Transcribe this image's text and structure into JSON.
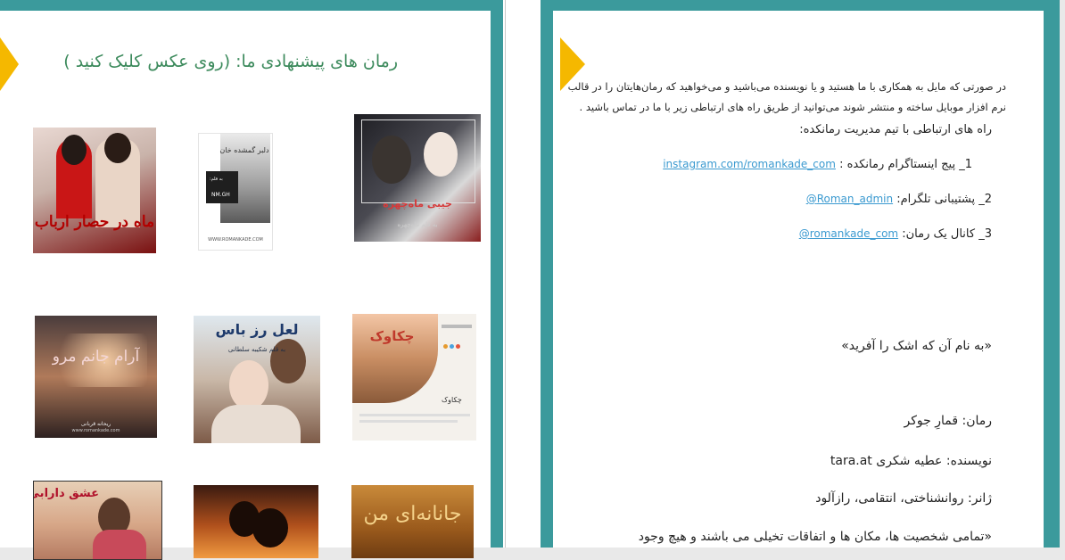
{
  "left_page": {
    "title": "رمان های پیشنهادی ما: (روی عکس کلیک کنید )",
    "covers": [
      {
        "name": "جیبی ماه‌چهره",
        "caption": "به قلم ماه‌چهره",
        "accent": "#c0392b"
      },
      {
        "name": "دلبر گمشده خان",
        "byline": "به قلم:",
        "author": "NM.GH",
        "site": "WWW.ROMANKADE.COM"
      },
      {
        "name": "ماه در حصار ارباب",
        "accent": "#b30000"
      },
      {
        "name": "چکاوک",
        "subtitle": "چکاوک"
      },
      {
        "name": "لعل رز باس",
        "byline": "به قلم شکیبه سلطانی"
      },
      {
        "name": "آرام جانم مرو",
        "author": "ریحانه قربانی",
        "site": "www.romankade.com"
      },
      {
        "name": "جانانه‌ای من"
      },
      {
        "name": ""
      },
      {
        "name": "عشق دارابی"
      }
    ]
  },
  "right_page": {
    "intro": "در صورتی که مایل به همکاری با ما هستید و یا نویسنده می‌باشید و می‌خواهید که رمان‌هایتان را در قالب نرم افزار موبایل ساخته و منتشر شوند می‌توانید از طریق راه های ارتباطی زیر با ما در تماس باشید .",
    "contact_heading": "راه های ارتباطی با تیم مدیریت رمانکده:",
    "contacts": [
      {
        "label": "1_ پیج اینستاگرام رمانکده :",
        "link": "instagram.com/romankade_com"
      },
      {
        "label": "2_ پشتیبانی تلگرام:",
        "link": "Roman_admin@"
      },
      {
        "label": "3_ کانال یک رمان:",
        "link": "romankade_com@"
      }
    ],
    "dedication": "«به نام آن که اشک را آفرید»",
    "novel_line": "رمان: قمارِ جوکر",
    "author_line": "نویسنده: عطیه شکری tara.at",
    "genre_line": "ژانر: روانشناختی، انتقامی، رازآلود",
    "disclaimer": "«تمامی شخصیت ها، مکان ها و اتفاقات تخیلی می باشند و هیچ وجود"
  },
  "colors": {
    "frame": "#3b9a9c",
    "tab": "#f5b800",
    "title": "#3c8a5c",
    "link": "#3b9ad0"
  }
}
